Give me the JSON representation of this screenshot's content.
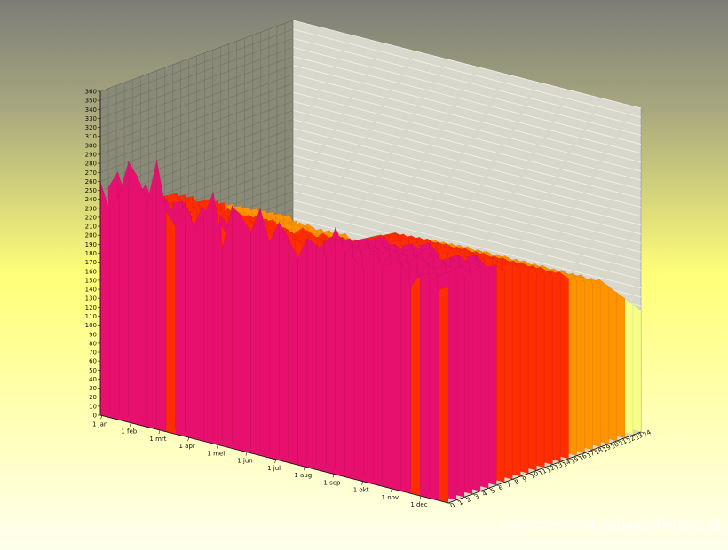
{
  "chart_data": {
    "type": "area",
    "surface_3d": true,
    "title": "",
    "xlabel": "",
    "ylabel": "",
    "zlabel": "",
    "x_tick_labels": [
      "1 jan",
      "1 feb",
      "1 mrt",
      "1 apr",
      "1 mei",
      "1 jun",
      "1 jul",
      "1 aug",
      "1 sep",
      "1 okt",
      "1 nov",
      "1 dec"
    ],
    "depth_tick_labels": [
      "0",
      "1",
      "2",
      "3",
      "4",
      "5",
      "6",
      "7",
      "8",
      "9",
      "10",
      "11",
      "12",
      "13",
      "14",
      "15",
      "16",
      "17",
      "18",
      "19",
      "20",
      "21",
      "22",
      "23",
      "24"
    ],
    "ylim": [
      0,
      360
    ],
    "y_tick_step": 10,
    "grid": true,
    "legend": "none",
    "color_bands": [
      {
        "from": 0,
        "to": 60,
        "color": "#8c9dff"
      },
      {
        "from": 60,
        "to": 100,
        "color": "#b8f0c8"
      },
      {
        "from": 100,
        "to": 150,
        "color": "#f6ff86"
      },
      {
        "from": 150,
        "to": 200,
        "color": "#ff9400"
      },
      {
        "from": 200,
        "to": 240,
        "color": "#ff2d00"
      },
      {
        "from": 240,
        "to": 285,
        "color": "#e8106e"
      },
      {
        "from": 285,
        "to": 360,
        "color": "#b53cf0"
      }
    ],
    "series": [
      {
        "values": [
          260,
          230,
          250,
          290,
          275,
          250,
          300,
          245,
          230,
          260,
          235,
          250,
          280,
          220,
          270,
          260,
          245,
          275,
          240,
          265,
          250,
          230,
          255,
          250,
          240,
          275,
          250,
          245,
          235,
          260,
          245,
          250,
          255,
          230,
          245,
          250,
          235,
          240
        ]
      },
      {
        "values": [
          250,
          270,
          240,
          245,
          265,
          235,
          255,
          240,
          250,
          230,
          255,
          245,
          240,
          225,
          245,
          240,
          250,
          235,
          245,
          240,
          230,
          245,
          235,
          250,
          260,
          240,
          255,
          245,
          250,
          240,
          255,
          245,
          250,
          240,
          255,
          245,
          250,
          255
        ]
      },
      {
        "values": [
          240,
          255,
          235,
          250,
          240,
          230,
          245,
          250,
          235,
          240,
          230,
          245,
          235,
          240,
          230,
          245,
          240,
          235,
          230,
          240,
          235,
          230,
          245,
          240,
          255,
          250,
          245,
          250,
          245,
          255,
          250,
          245,
          255,
          250,
          245,
          255,
          250,
          245
        ]
      },
      {
        "values": [
          235,
          240,
          245,
          230,
          235,
          240,
          225,
          235,
          230,
          235,
          225,
          240,
          230,
          235,
          225,
          235,
          230,
          225,
          235,
          230,
          225,
          240,
          235,
          245,
          250,
          240,
          250,
          245,
          240,
          250,
          245,
          250,
          245,
          240,
          250,
          245,
          250,
          240
        ]
      },
      {
        "values": [
          230,
          235,
          230,
          240,
          225,
          235,
          230,
          225,
          235,
          230,
          220,
          235,
          225,
          230,
          220,
          230,
          225,
          235,
          220,
          230,
          225,
          230,
          235,
          240,
          245,
          250,
          240,
          245,
          250,
          240,
          245,
          240,
          250,
          245,
          240,
          245,
          240,
          250
        ]
      },
      {
        "values": [
          225,
          230,
          240,
          225,
          235,
          220,
          230,
          225,
          220,
          225,
          230,
          220,
          230,
          225,
          215,
          225,
          230,
          220,
          225,
          220,
          230,
          225,
          230,
          235,
          240,
          245,
          240,
          245,
          240,
          245,
          240,
          245,
          240,
          245,
          240,
          245,
          245,
          240
        ]
      },
      {
        "values": [
          220,
          225,
          230,
          235,
          220,
          225,
          215,
          230,
          225,
          220,
          215,
          225,
          220,
          215,
          225,
          220,
          215,
          225,
          220,
          225,
          220,
          230,
          225,
          235,
          240,
          245,
          235,
          240,
          245,
          240,
          245,
          235,
          240,
          245,
          240,
          245,
          240,
          245
        ]
      },
      {
        "values": [
          215,
          220,
          225,
          230,
          215,
          220,
          225,
          215,
          220,
          215,
          225,
          220,
          215,
          210,
          220,
          215,
          225,
          220,
          215,
          220,
          225,
          220,
          230,
          235,
          240,
          235,
          240,
          235,
          240,
          245,
          235,
          240,
          235,
          240,
          245,
          235,
          240,
          235
        ]
      },
      {
        "values": [
          210,
          215,
          220,
          225,
          210,
          215,
          220,
          210,
          215,
          220,
          210,
          215,
          210,
          215,
          205,
          215,
          210,
          215,
          220,
          215,
          220,
          225,
          230,
          235,
          230,
          235,
          240,
          235,
          230,
          235,
          240,
          235,
          230,
          240,
          235,
          230,
          235,
          240
        ]
      },
      {
        "values": [
          205,
          210,
          215,
          210,
          220,
          205,
          215,
          210,
          205,
          210,
          215,
          205,
          210,
          200,
          210,
          205,
          215,
          210,
          205,
          210,
          215,
          220,
          225,
          230,
          235,
          230,
          235,
          230,
          235,
          230,
          235,
          230,
          235,
          230,
          235,
          230,
          235,
          230
        ]
      },
      {
        "values": [
          200,
          205,
          210,
          215,
          200,
          210,
          205,
          200,
          210,
          205,
          200,
          205,
          200,
          210,
          200,
          205,
          200,
          210,
          205,
          210,
          215,
          220,
          225,
          230,
          225,
          230,
          225,
          230,
          225,
          230,
          225,
          230,
          225,
          230,
          225,
          230,
          225,
          230
        ]
      },
      {
        "values": [
          195,
          200,
          205,
          210,
          195,
          205,
          200,
          195,
          200,
          205,
          195,
          200,
          195,
          200,
          195,
          200,
          205,
          200,
          205,
          210,
          215,
          220,
          225,
          220,
          225,
          220,
          225,
          220,
          225,
          220,
          225,
          220,
          225,
          220,
          225,
          220,
          225,
          220
        ]
      },
      {
        "values": [
          190,
          195,
          200,
          205,
          190,
          200,
          195,
          190,
          195,
          200,
          190,
          195,
          190,
          195,
          190,
          195,
          200,
          195,
          200,
          205,
          210,
          215,
          220,
          215,
          220,
          215,
          220,
          215,
          220,
          215,
          220,
          215,
          220,
          215,
          220,
          215,
          220,
          215
        ]
      },
      {
        "values": [
          185,
          190,
          195,
          200,
          185,
          195,
          190,
          185,
          190,
          195,
          185,
          190,
          185,
          190,
          185,
          190,
          195,
          190,
          195,
          200,
          205,
          210,
          215,
          210,
          215,
          210,
          215,
          210,
          215,
          210,
          215,
          210,
          215,
          210,
          215,
          210,
          215,
          210
        ]
      },
      {
        "values": [
          180,
          185,
          190,
          195,
          180,
          190,
          185,
          180,
          185,
          190,
          180,
          185,
          180,
          185,
          180,
          185,
          190,
          185,
          190,
          195,
          200,
          205,
          210,
          205,
          210,
          205,
          210,
          205,
          210,
          205,
          210,
          205,
          210,
          205,
          210,
          205,
          210,
          205
        ]
      },
      {
        "values": [
          175,
          180,
          185,
          190,
          175,
          185,
          180,
          175,
          180,
          185,
          175,
          180,
          175,
          180,
          175,
          180,
          185,
          180,
          185,
          190,
          195,
          200,
          205,
          200,
          205,
          200,
          205,
          200,
          205,
          200,
          205,
          200,
          205,
          200,
          205,
          200,
          205,
          200
        ]
      },
      {
        "values": [
          170,
          175,
          180,
          185,
          170,
          180,
          175,
          170,
          175,
          180,
          170,
          175,
          170,
          175,
          170,
          175,
          180,
          175,
          180,
          185,
          190,
          195,
          200,
          195,
          200,
          195,
          200,
          195,
          200,
          195,
          200,
          195,
          200,
          195,
          200,
          195,
          200,
          195
        ]
      },
      {
        "values": [
          165,
          170,
          175,
          180,
          165,
          175,
          170,
          165,
          170,
          175,
          165,
          170,
          165,
          170,
          165,
          170,
          175,
          170,
          175,
          180,
          185,
          190,
          195,
          190,
          195,
          190,
          195,
          190,
          195,
          190,
          195,
          190,
          195,
          190,
          195,
          190,
          195,
          190
        ]
      },
      {
        "values": [
          160,
          165,
          170,
          175,
          160,
          170,
          165,
          160,
          165,
          170,
          160,
          165,
          160,
          165,
          160,
          165,
          170,
          165,
          170,
          175,
          180,
          185,
          190,
          185,
          190,
          185,
          190,
          185,
          190,
          185,
          190,
          185,
          190,
          185,
          190,
          185,
          190,
          185
        ]
      },
      {
        "values": [
          155,
          160,
          165,
          170,
          155,
          165,
          160,
          155,
          160,
          165,
          155,
          160,
          155,
          160,
          155,
          160,
          165,
          160,
          165,
          170,
          175,
          180,
          185,
          180,
          185,
          180,
          185,
          180,
          185,
          180,
          185,
          180,
          185,
          180,
          185,
          180,
          185,
          180
        ]
      },
      {
        "values": [
          150,
          155,
          160,
          165,
          150,
          160,
          155,
          150,
          155,
          160,
          150,
          155,
          150,
          155,
          150,
          155,
          160,
          155,
          160,
          165,
          170,
          175,
          180,
          175,
          180,
          175,
          180,
          175,
          180,
          175,
          180,
          175,
          180,
          175,
          180,
          175,
          180,
          175
        ]
      },
      {
        "values": [
          140,
          145,
          150,
          155,
          140,
          150,
          145,
          140,
          145,
          150,
          140,
          145,
          140,
          145,
          140,
          145,
          150,
          145,
          150,
          155,
          160,
          165,
          170,
          165,
          170,
          165,
          170,
          165,
          170,
          165,
          170,
          165,
          170,
          165,
          170,
          165,
          170,
          165
        ]
      },
      {
        "values": [
          130,
          135,
          140,
          145,
          130,
          140,
          135,
          130,
          135,
          140,
          130,
          135,
          130,
          135,
          130,
          135,
          140,
          135,
          140,
          145,
          150,
          155,
          160,
          155,
          160,
          155,
          160,
          155,
          160,
          155,
          160,
          155,
          160,
          155,
          160,
          155,
          160,
          155
        ]
      },
      {
        "values": [
          120,
          125,
          130,
          135,
          120,
          130,
          125,
          120,
          125,
          130,
          120,
          125,
          120,
          125,
          120,
          125,
          130,
          125,
          130,
          135,
          140,
          145,
          150,
          145,
          150,
          145,
          150,
          145,
          150,
          145,
          150,
          145,
          150,
          145,
          150,
          145,
          150,
          145
        ]
      },
      {
        "values": [
          110,
          115,
          120,
          125,
          110,
          120,
          115,
          110,
          115,
          120,
          110,
          115,
          110,
          115,
          110,
          115,
          120,
          115,
          120,
          125,
          130,
          135,
          140,
          135,
          140,
          135,
          140,
          135,
          140,
          135,
          140,
          135,
          140,
          135,
          140,
          135,
          140,
          135
        ]
      }
    ]
  },
  "watermark": "www.weerstationhaaksbergen.nl"
}
